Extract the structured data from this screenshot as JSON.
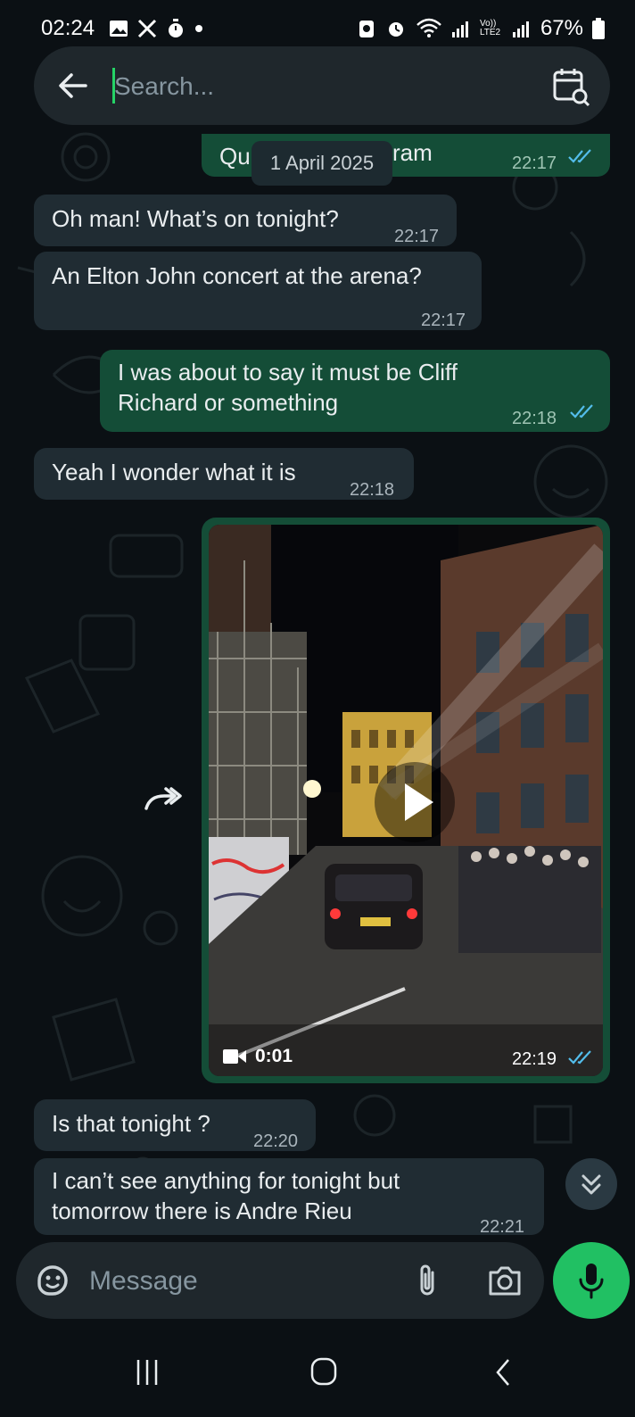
{
  "status_bar": {
    "time": "02:24",
    "battery": "67%",
    "network": "Vo)) LTE2"
  },
  "search": {
    "placeholder": "Search..."
  },
  "date_chip": "1 April 2025",
  "messages": [
    {
      "dir": "out",
      "text_left": "Qu",
      "text_right": "ram",
      "time": "22:17",
      "ticks": "read"
    },
    {
      "dir": "in",
      "text": "Oh man! What’s on tonight?",
      "time": "22:17"
    },
    {
      "dir": "in",
      "text": "An Elton John concert at the arena?",
      "time": "22:17"
    },
    {
      "dir": "out",
      "text_line1": "I was about to say it must be Cliff",
      "text_line2": "Richard or something",
      "time": "22:18",
      "ticks": "read"
    },
    {
      "dir": "in",
      "text": "Yeah I wonder what it is",
      "time": "22:18"
    },
    {
      "dir": "out",
      "type": "video",
      "duration": "0:01",
      "time": "22:19",
      "ticks": "read"
    },
    {
      "dir": "in",
      "text": "Is that tonight ?",
      "time": "22:20"
    },
    {
      "dir": "in",
      "text_line1": "I can’t see anything for tonight but",
      "text_line2": "tomorrow there is Andre Rieu",
      "time": "22:21"
    }
  ],
  "composer": {
    "placeholder": "Message"
  },
  "icons": {
    "back": "arrow-left-icon",
    "date_search": "calendar-search-icon",
    "forward": "forward-icon",
    "play": "play-icon",
    "video": "video-camera-icon",
    "scroll_down": "double-chevron-down-icon",
    "emoji": "sticker-icon",
    "attach": "paperclip-icon",
    "camera": "camera-icon",
    "mic": "microphone-icon"
  },
  "colors": {
    "background": "#0b1014",
    "incoming_bubble": "#202c33",
    "outgoing_bubble": "#144d37",
    "accent_green": "#21c063",
    "read_ticks": "#53bdeb"
  }
}
